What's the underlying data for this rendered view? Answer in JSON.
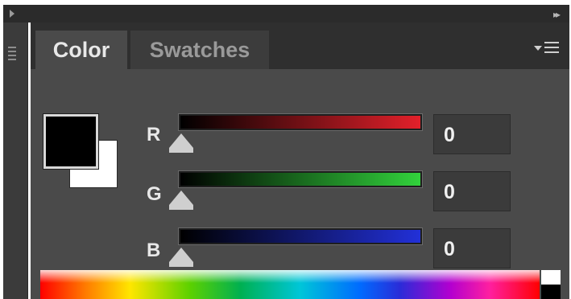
{
  "panel": {
    "tabs": [
      {
        "label": "Color",
        "active": true
      },
      {
        "label": "Swatches",
        "active": false
      }
    ],
    "menu_icon": "panel-menu-icon"
  },
  "swatches": {
    "foreground": "#000000",
    "background": "#ffffff"
  },
  "sliders": [
    {
      "channel": "R",
      "value": "0",
      "ramp_end_color": "#e3202a"
    },
    {
      "channel": "G",
      "value": "0",
      "ramp_end_color": "#32d23c"
    },
    {
      "channel": "B",
      "value": "0",
      "ramp_end_color": "#2230d8"
    }
  ],
  "colors": {
    "panel_bg": "#4a4a4a",
    "tab_bar_bg": "#2f2f2f",
    "field_bg": "#3b3b3b"
  }
}
